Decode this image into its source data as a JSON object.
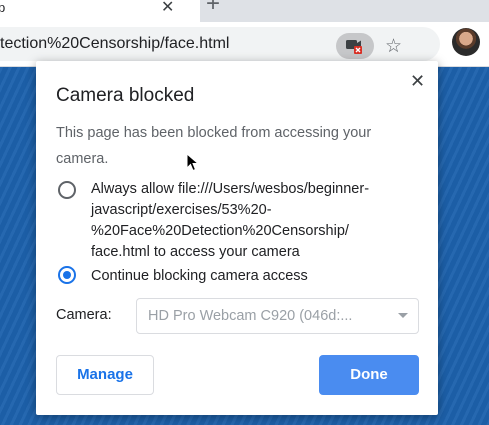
{
  "browser": {
    "tab_title": "p",
    "tab_close": "✕",
    "new_tab": "+",
    "url": "tection%20Censorship/face.html"
  },
  "dialog": {
    "title": "Camera blocked",
    "close": "✕",
    "description": "This page has been blocked from accessing your camera.",
    "options": [
      {
        "label": "Always allow file:///Users/wesbos/beginner-javascript/exercises/53%20-%20Face%20Detection%20Censorship/face.html to access your camera",
        "lines": [
          "Always allow file:///Users/wesbos/beginner-",
          "javascript/exercises/53%20-",
          "%20Face%20Detection%20Censorship/",
          "face.html to access your camera"
        ],
        "selected": false
      },
      {
        "label": "Continue blocking camera access",
        "selected": true
      }
    ],
    "camera_label": "Camera:",
    "camera_value": "HD Pro Webcam C920 (046d:...",
    "manage_button": "Manage",
    "done_button": "Done"
  },
  "colors": {
    "accent": "#1a73e8",
    "done_bg": "#4a8cf0",
    "page_bg": "#1d62ad",
    "blocked_badge": "#d93025"
  },
  "icons": [
    "camera-blocked-icon",
    "star-icon",
    "close-icon",
    "dropdown-arrow-icon",
    "mouse-cursor"
  ]
}
